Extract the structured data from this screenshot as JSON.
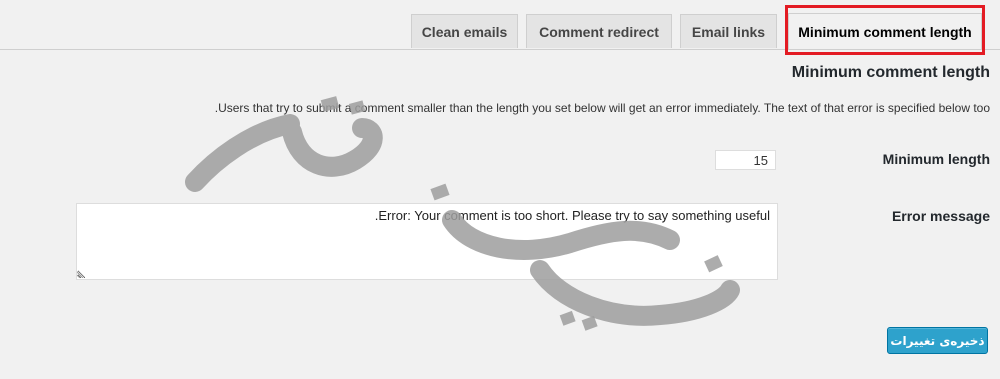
{
  "tabs": [
    {
      "label": "Clean emails",
      "active": false
    },
    {
      "label": "Comment redirect",
      "active": false
    },
    {
      "label": "Email links",
      "active": false
    },
    {
      "label": "Minimum comment length",
      "active": true
    }
  ],
  "highlight_color": "#e31b23",
  "page_title": "Minimum comment length",
  "description": "Users that try to submit a comment smaller than the length you set below will get an error immediately. The text of that error is specified below too.",
  "fields": {
    "min_length": {
      "label": "Minimum length",
      "value": "15"
    },
    "error_message": {
      "label": "Error message",
      "value": "Error: Your comment is too short. Please try to say something useful."
    }
  },
  "save_button": {
    "label": "ذخیره‌ی تغییرات",
    "color": "#2ea2cc"
  }
}
